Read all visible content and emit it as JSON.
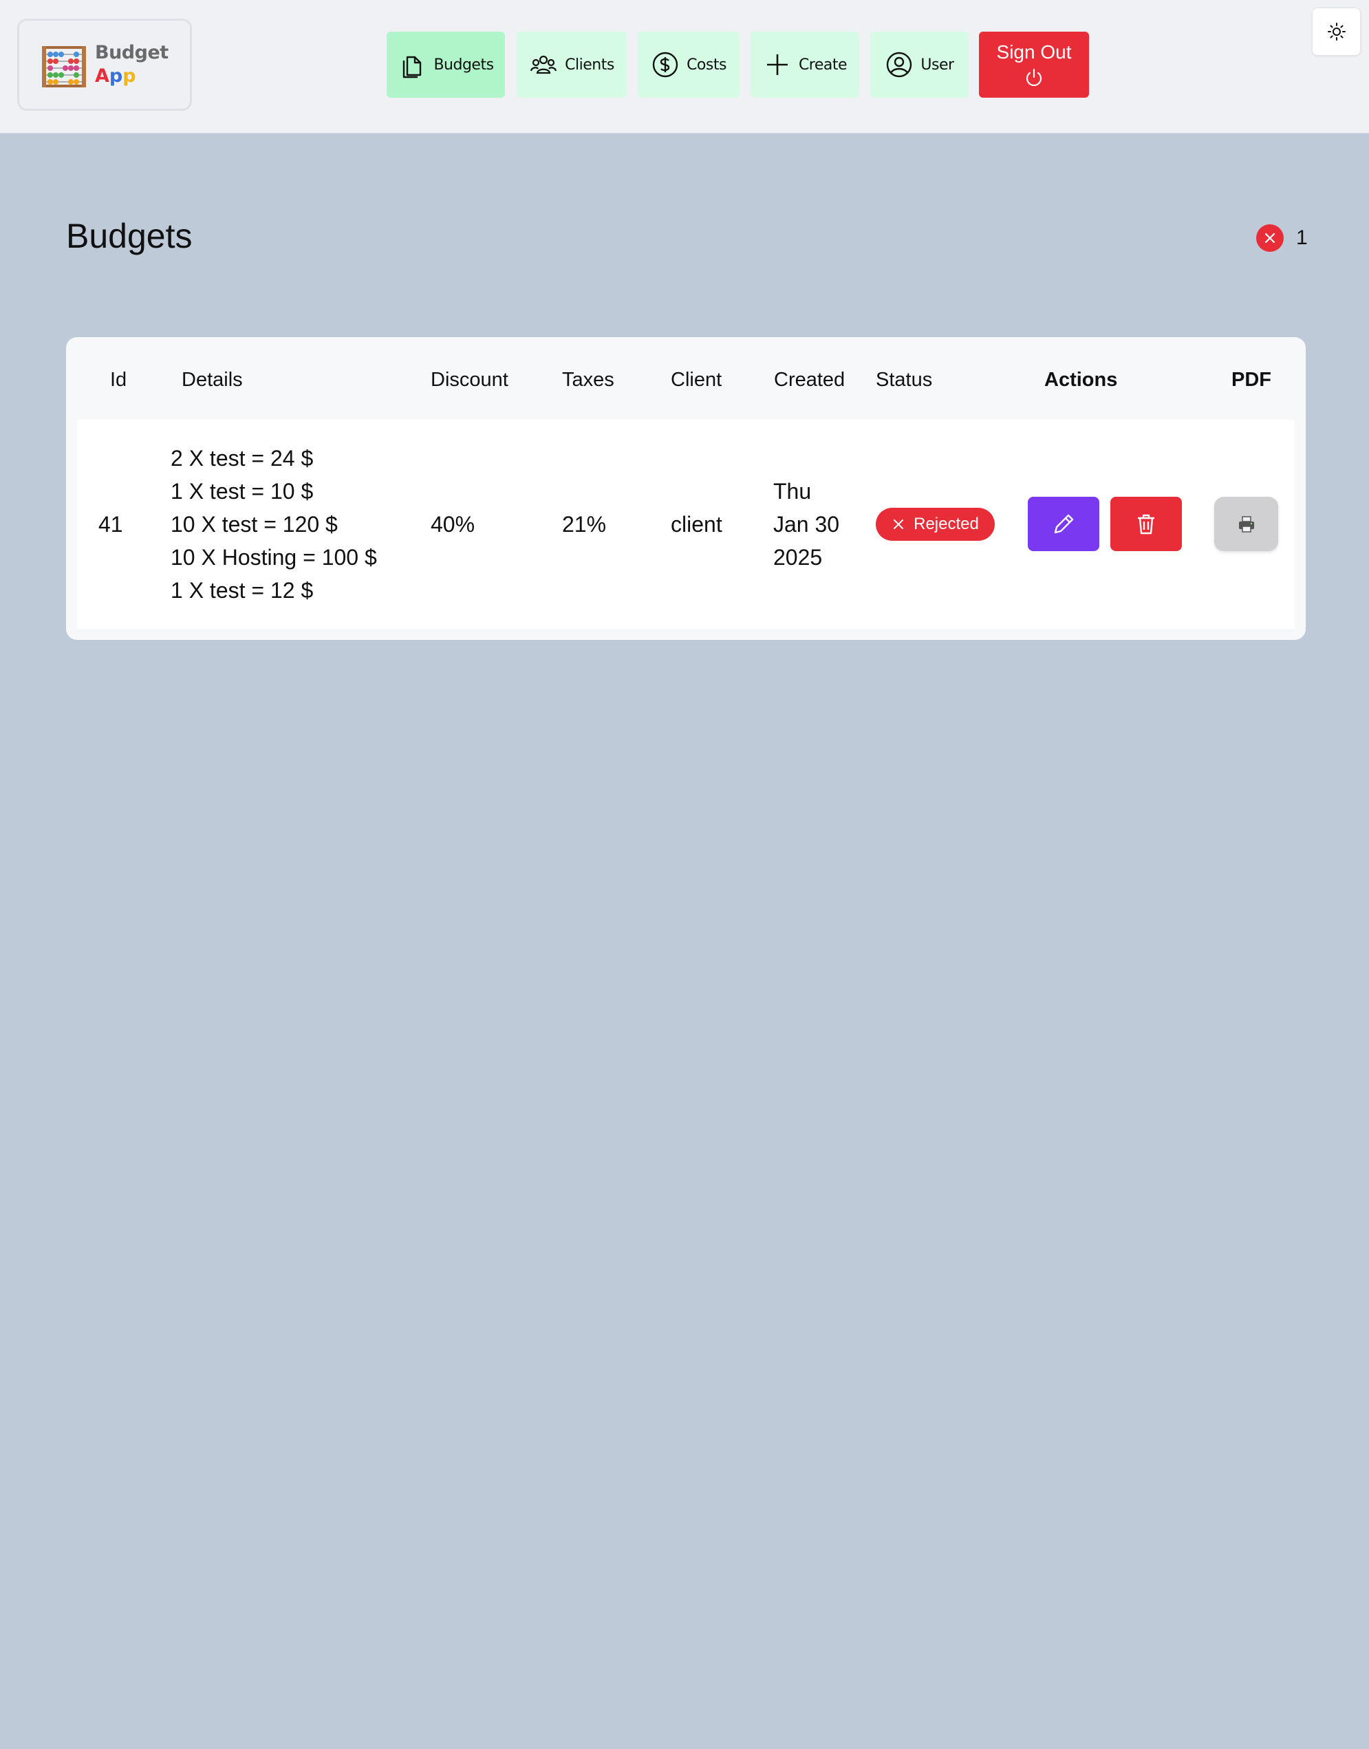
{
  "app": {
    "logo_line1": "Budget",
    "logo_line2_letters": [
      "A",
      "p",
      "p"
    ],
    "logo_line2_colors": [
      "#e82c38",
      "#3a6fe0",
      "#f2b51b"
    ]
  },
  "nav": {
    "items": [
      {
        "label": "Budgets",
        "icon": "documents-icon",
        "active": true
      },
      {
        "label": "Clients",
        "icon": "users-icon",
        "active": false
      },
      {
        "label": "Costs",
        "icon": "dollar-icon",
        "active": false
      },
      {
        "label": "Create",
        "icon": "plus-icon",
        "active": false
      },
      {
        "label": "User",
        "icon": "user-circle-icon",
        "active": false
      }
    ],
    "signout_label": "Sign Out",
    "signout_icon": "power-icon"
  },
  "theme_toggle_icon": "sun-icon",
  "page": {
    "title": "Budgets",
    "rejected_count": "1"
  },
  "table": {
    "headers": {
      "id": "Id",
      "details": "Details",
      "discount": "Discount",
      "taxes": "Taxes",
      "client": "Client",
      "created": "Created",
      "status": "Status",
      "actions": "Actions",
      "pdf": "PDF"
    },
    "rows": [
      {
        "id": "41",
        "details": [
          "2 X test = 24 $",
          "1 X test = 10 $",
          "10 X test = 120 $",
          "10 X Hosting = 100 $",
          "1 X test = 12 $"
        ],
        "discount": "40%",
        "taxes": "21%",
        "client": "client",
        "created": [
          "Thu",
          "Jan 30",
          "2025"
        ],
        "status": "Rejected"
      }
    ]
  },
  "colors": {
    "background": "#bfcad9",
    "nav_button": "#d5fbe4",
    "nav_active": "#b0f5c9",
    "danger": "#e82c38",
    "edit": "#7a38f0"
  }
}
